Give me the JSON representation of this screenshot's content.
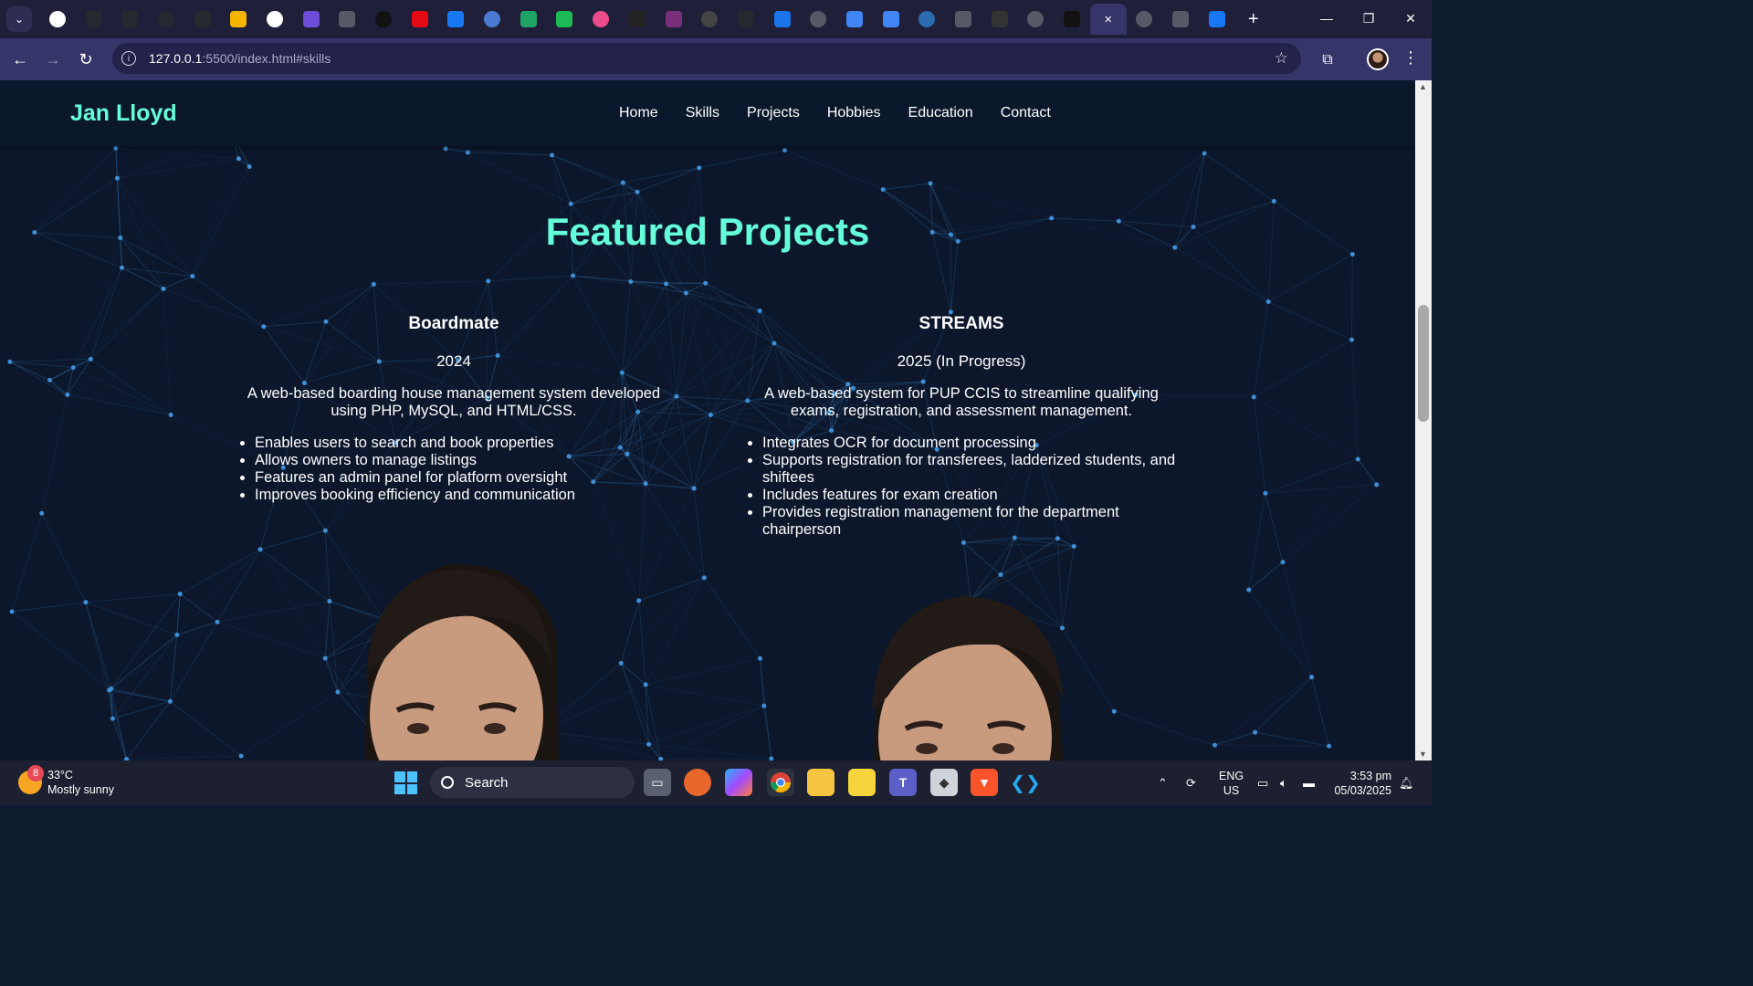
{
  "browser": {
    "tab_count": 33,
    "address_host": "127.0.0.1",
    "address_rest": ":5500/index.html#skills",
    "window_controls": [
      "minimize",
      "restore",
      "close"
    ]
  },
  "site": {
    "brand": "Jan Lloyd",
    "nav": [
      "Home",
      "Skills",
      "Projects",
      "Hobbies",
      "Education",
      "Contact"
    ],
    "section_title": "Featured Projects",
    "accent_color": "#64ffda",
    "projects": [
      {
        "name": "Boardmate",
        "year": "2024",
        "description": "A web-based boarding house management system developed using PHP, MySQL, and HTML/CSS.",
        "features": [
          "Enables users to search and book properties",
          "Allows owners to manage listings",
          "Features an admin panel for platform oversight",
          "Improves booking efficiency and communication"
        ]
      },
      {
        "name": "STREAMS",
        "year": "2025 (In Progress)",
        "description": "A web-based system for PUP CCIS to streamline qualifying exams, registration, and assessment management.",
        "features": [
          "Integrates OCR for document processing",
          "Supports registration for transferees, ladderized students, and shiftees",
          "Includes features for exam creation",
          "Provides registration management for the department chairperson"
        ]
      }
    ]
  },
  "taskbar": {
    "weather_badge": "8",
    "temperature": "33°C",
    "condition": "Mostly sunny",
    "search_label": "Search",
    "language_line1": "ENG",
    "language_line2": "US",
    "time": "3:53 pm",
    "date": "05/03/2025"
  }
}
